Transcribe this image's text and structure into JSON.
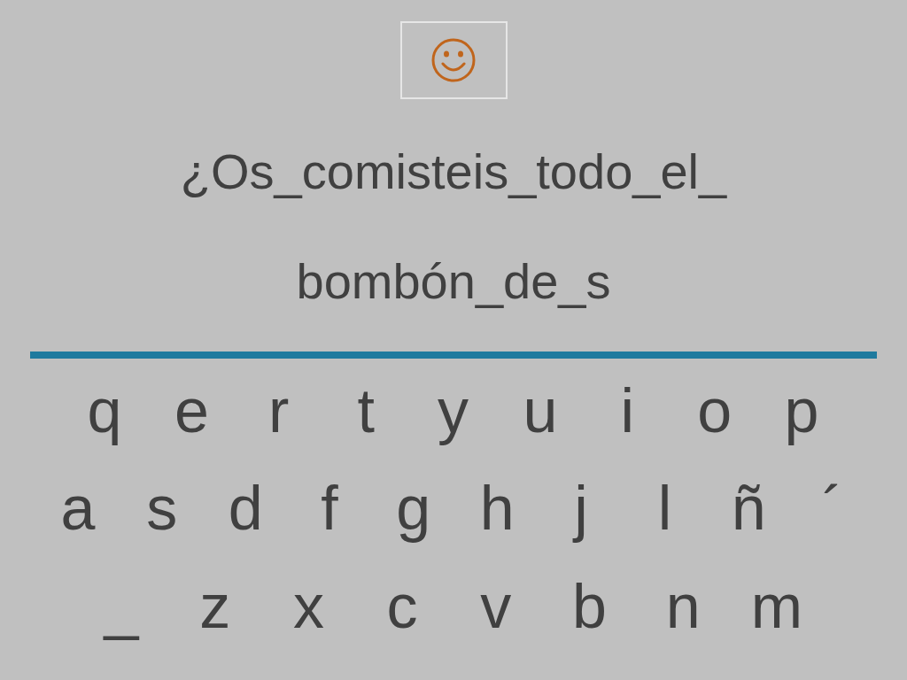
{
  "prompt_lines": [
    "¿Os_comisteis_todo_el_",
    "bombón_de_s"
  ],
  "keyboard": {
    "rows": [
      [
        "q",
        "e",
        "r",
        "t",
        "y",
        "u",
        "i",
        "o",
        "p"
      ],
      [
        "a",
        "s",
        "d",
        "f",
        "g",
        "h",
        "j",
        "l",
        "ñ",
        "´"
      ],
      [
        "_",
        "z",
        "x",
        "c",
        "v",
        "b",
        "n",
        "m"
      ]
    ]
  }
}
